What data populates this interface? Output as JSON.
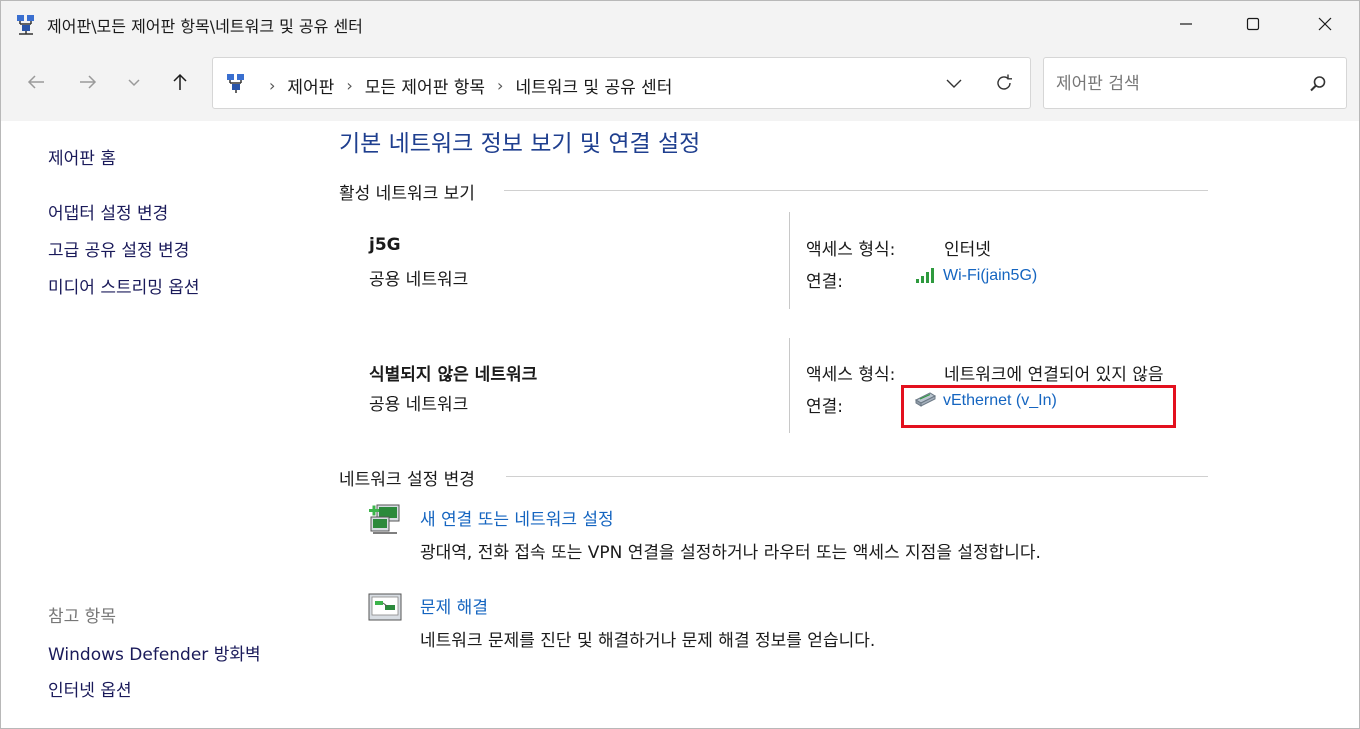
{
  "window": {
    "title": "제어판\\모든 제어판 항목\\네트워크 및 공유 센터"
  },
  "address": {
    "crumbs": [
      "제어판",
      "모든 제어판 항목",
      "네트워크 및 공유 센터"
    ],
    "separator": "›"
  },
  "search": {
    "placeholder": "제어판 검색"
  },
  "sidebar": {
    "home": "제어판 홈",
    "items": [
      "어댑터 설정 변경",
      "고급 공유 설정 변경",
      "미디어 스트리밍 옵션"
    ],
    "see_also_label": "참고 항목",
    "see_also": [
      "Windows Defender 방화벽",
      "인터넷 옵션"
    ]
  },
  "main": {
    "title": "기본 네트워크 정보 보기 및 연결 설정",
    "active_networks_heading": "활성 네트워크 보기",
    "networks": [
      {
        "name": "j5G",
        "type": "공용 네트워크",
        "access_label": "액세스 형식:",
        "access_value": "인터넷",
        "connection_label": "연결:",
        "connection_value": "Wi-Fi(jain5G)",
        "connection_icon": "wifi-signal-icon"
      },
      {
        "name": "식별되지 않은 네트워크",
        "type": "공용 네트워크",
        "access_label": "액세스 형식:",
        "access_value": "네트워크에 연결되어 있지 않음",
        "connection_label": "연결:",
        "connection_value": "vEthernet (v_In)",
        "connection_icon": "ethernet-adapter-icon"
      }
    ],
    "change_heading": "네트워크 설정 변경",
    "tasks": [
      {
        "link": "새 연결 또는 네트워크 설정",
        "desc": "광대역, 전화 접속 또는 VPN 연결을 설정하거나 라우터 또는 액세스 지점을 설정합니다.",
        "icon": "new-connection-icon"
      },
      {
        "link": "문제 해결",
        "desc": "네트워크 문제를 진단 및 해결하거나 문제 해결 정보를 얻습니다.",
        "icon": "troubleshoot-icon"
      }
    ]
  },
  "colors": {
    "title_blue": "#1f3f8f",
    "link_blue": "#1565c0",
    "highlight_red": "#e3101e",
    "chrome_bg": "#f3f3f3"
  }
}
